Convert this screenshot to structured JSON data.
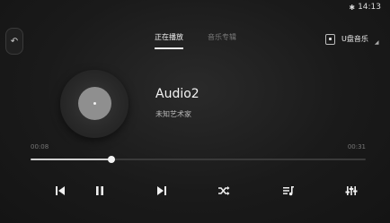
{
  "status_bar": {
    "bluetooth_icon": "bluetooth-icon",
    "time": "14:13"
  },
  "back_button": {
    "icon": "back-icon"
  },
  "tabs": [
    {
      "label": "正在播放",
      "active": true
    },
    {
      "label": "音乐专辑",
      "active": false
    }
  ],
  "source": {
    "icon": "usb-icon",
    "label": "U盘音乐",
    "dropdown_icon": "chevron-down-icon"
  },
  "album_art": {
    "icon": "vinyl-record-icon"
  },
  "track": {
    "title": "Audio2",
    "artist": "未知艺术家"
  },
  "playback": {
    "elapsed": "00:08",
    "total": "00:31",
    "progress_fraction": 0.24
  },
  "controls": [
    {
      "name": "previous-button",
      "icon": "skip-previous-icon"
    },
    {
      "name": "pause-button",
      "icon": "pause-icon"
    },
    {
      "name": "next-button",
      "icon": "skip-next-icon"
    },
    {
      "name": "shuffle-button",
      "icon": "shuffle-icon"
    },
    {
      "name": "playlist-button",
      "icon": "playlist-icon"
    },
    {
      "name": "equalizer-button",
      "icon": "equalizer-icon"
    }
  ],
  "colors": {
    "background": "#1a1a1a",
    "accent": "#f2f2f2",
    "muted_text": "#777777"
  }
}
